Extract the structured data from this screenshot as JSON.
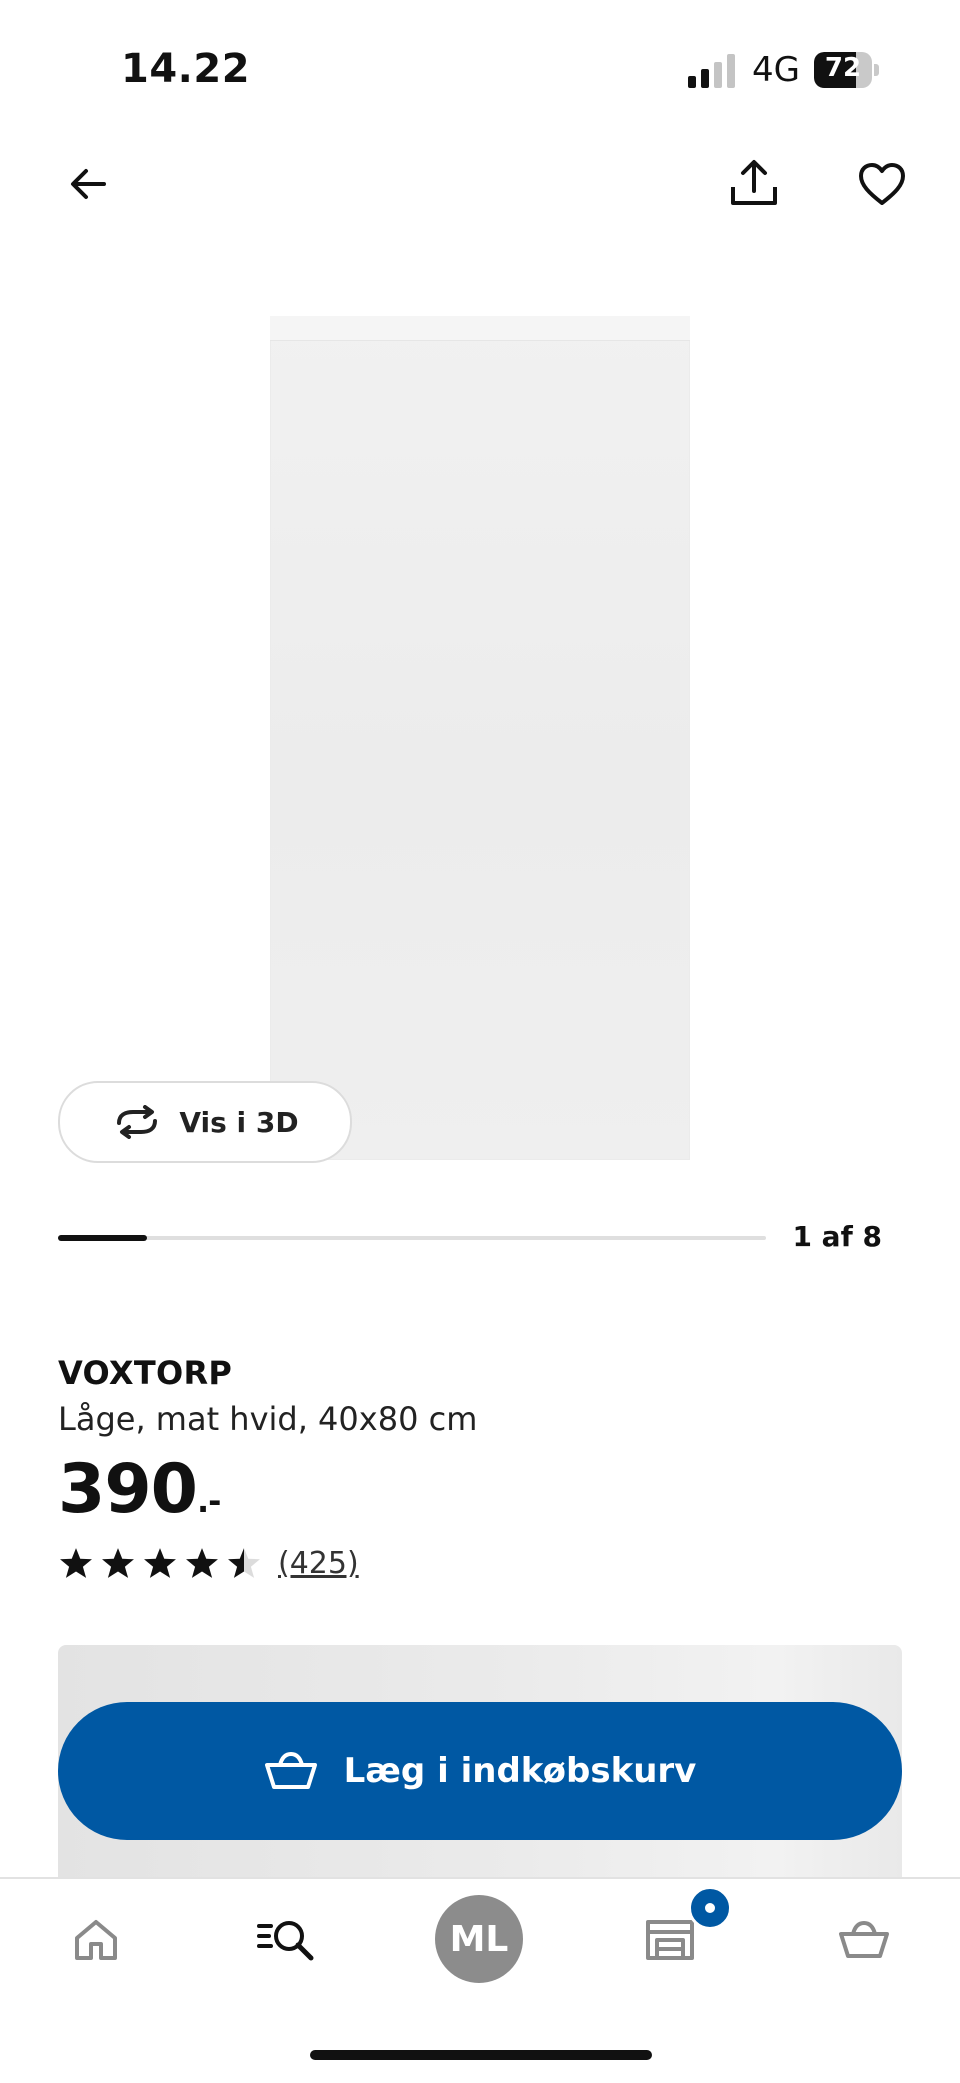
{
  "status_bar": {
    "time": "14.22",
    "network": "4G",
    "battery": "72"
  },
  "header": {
    "back_icon": "arrow-left-icon",
    "share_icon": "share-icon",
    "favorite_icon": "heart-icon"
  },
  "gallery": {
    "view_3d_label": "Vis i 3D",
    "view_3d_icon": "rotate-arrows-icon",
    "counter": "1 af 8",
    "current_image": 1,
    "total_images": 8
  },
  "product": {
    "name": "VOXTORP",
    "description": "Låge, mat hvid, 40x80 cm",
    "price": "390",
    "price_suffix": ".-",
    "rating": 4.5,
    "rating_max": 5,
    "review_count": "(425)"
  },
  "cta": {
    "label": "Læg i indkøbskurv",
    "icon": "basket-icon"
  },
  "tab_bar": {
    "items": [
      {
        "name": "home",
        "icon": "home-icon"
      },
      {
        "name": "search",
        "icon": "search-icon"
      },
      {
        "name": "profile",
        "icon": "avatar",
        "initials": "ML"
      },
      {
        "name": "store",
        "icon": "store-icon"
      },
      {
        "name": "cart",
        "icon": "basket-icon"
      }
    ]
  },
  "colors": {
    "accent": "#0058a3",
    "text": "#111111",
    "avatar_bg": "#8c8c8c"
  }
}
